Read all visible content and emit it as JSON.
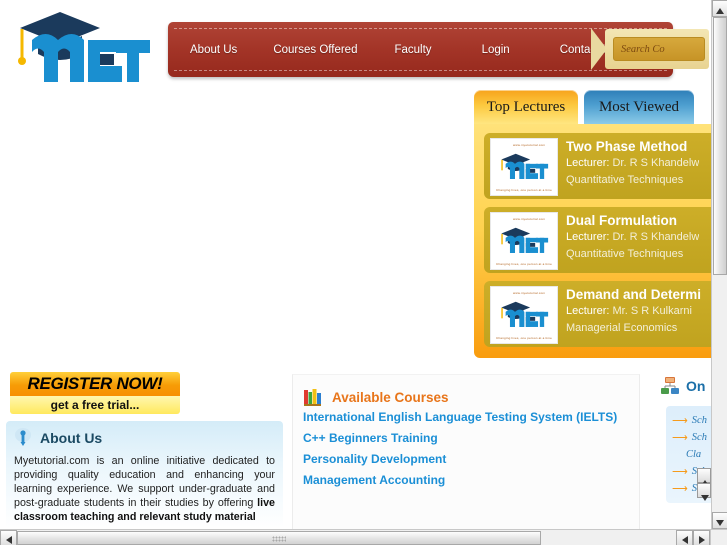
{
  "site": {
    "logo_text": "MET",
    "logo_icon": "graduation-cap-icon"
  },
  "nav": {
    "items": [
      {
        "label": "About Us"
      },
      {
        "label": "Courses Offered"
      },
      {
        "label": "Faculty"
      },
      {
        "label": "Login"
      },
      {
        "label": "Contact Us"
      }
    ]
  },
  "search": {
    "placeholder": "Search Co",
    "value": "",
    "icon": "search-icon"
  },
  "lectures": {
    "tabs": [
      {
        "label": "Top Lectures",
        "active": true
      },
      {
        "label": "Most Viewed",
        "active": false
      }
    ],
    "lecturer_label": "Lecturer:",
    "items": [
      {
        "title": "Two Phase Method",
        "lecturer": "Dr. R S Khandelw",
        "subject": "Quantitative Techniques",
        "thumb_top": "www.myetutorial.com",
        "thumb_bottom": "Changing lives, one person at a time"
      },
      {
        "title": "Dual Formulation",
        "lecturer": "Dr. R S Khandelw",
        "subject": "Quantitative Techniques",
        "thumb_top": "www.myetutorial.com",
        "thumb_bottom": "Changing lives, one person at a time"
      },
      {
        "title": "Demand and Determi",
        "lecturer": "Mr. S R Kulkarni",
        "subject": "Managerial Economics",
        "thumb_top": "www.myetutorial.com",
        "thumb_bottom": "Changing lives, one person at a time"
      }
    ]
  },
  "register": {
    "headline": "REGISTER NOW!",
    "subline": "get a free trial..."
  },
  "about": {
    "icon": "info-bulb-icon",
    "title": "About Us",
    "paragraph_lead": "Myetutorial.com is an online initiative dedicated to providing quality education and enhancing your learning experience. We support under-graduate and post-graduate students in their studies by offering ",
    "paragraph_bold": "live classroom teaching and relevant study material"
  },
  "courses": {
    "icon": "books-icon",
    "title": "Available Courses",
    "items": [
      {
        "label": "International English Language Testing System (IELTS)"
      },
      {
        "label": "C++ Beginners Training"
      },
      {
        "label": "Personality Development"
      },
      {
        "label": "Management Accounting"
      }
    ]
  },
  "online": {
    "icon": "network-icon",
    "title": "On",
    "items": [
      {
        "label": "Sch",
        "arrow": true
      },
      {
        "label": "Sch",
        "arrow": true
      },
      {
        "label": "Cla",
        "arrow": false
      },
      {
        "label": "Sch",
        "arrow": true
      },
      {
        "label": "Sch",
        "arrow": true
      }
    ]
  },
  "colors": {
    "nav_red": "#a33427",
    "tab_orange": "#f7a31c",
    "tab_blue": "#2e7fb8",
    "link_blue": "#1b8fd6",
    "heading_orange": "#e8751a",
    "card_olive": "#c0a31f",
    "gold": "#d6a83c"
  }
}
